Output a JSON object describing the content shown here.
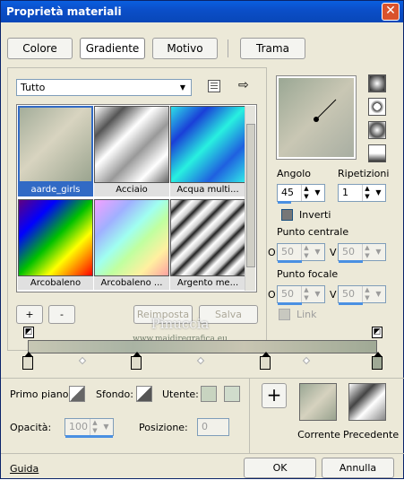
{
  "title": "Proprietà materiali",
  "tabs": [
    "Colore",
    "Gradiente",
    "Motivo",
    "Trama"
  ],
  "category": "Tutto",
  "gallery": [
    {
      "label": "aarde_girls",
      "selected": true
    },
    {
      "label": "Acciaio"
    },
    {
      "label": "Acqua multi..."
    },
    {
      "label": "Arcobaleno"
    },
    {
      "label": "Arcobaleno ..."
    },
    {
      "label": "Argento me..."
    }
  ],
  "buttons": {
    "add": "+",
    "remove": "-",
    "reset": "Reimposta",
    "save": "Salva"
  },
  "angle": {
    "label": "Angolo",
    "value": "45"
  },
  "repeats": {
    "label": "Ripetizioni",
    "value": "1"
  },
  "invert": {
    "label": "Inverti"
  },
  "center_point": {
    "label": "Punto centrale",
    "h_label": "O",
    "h_value": "50",
    "v_label": "V",
    "v_value": "50"
  },
  "focal_point": {
    "label": "Punto focale",
    "h_label": "O",
    "h_value": "50",
    "v_label": "V",
    "v_value": "50"
  },
  "link": {
    "label": "Link"
  },
  "watermark": {
    "line1": "Pinuccia",
    "line2": "www.maidiregrafica.eu"
  },
  "bottom": {
    "foreground": "Primo piano:",
    "background": "Sfondo:",
    "user": "Utente:",
    "opacity_label": "Opacità:",
    "opacity_value": "100",
    "position_label": "Posizione:",
    "position_value": "0",
    "add_icon": "+",
    "current": "Corrente",
    "previous": "Precedente"
  },
  "footer": {
    "help": "Guida",
    "ok": "OK",
    "cancel": "Annulla"
  },
  "colors": {
    "accent": "#316ac5",
    "titlebar": "#0b4fc9",
    "close": "#d9522c"
  }
}
